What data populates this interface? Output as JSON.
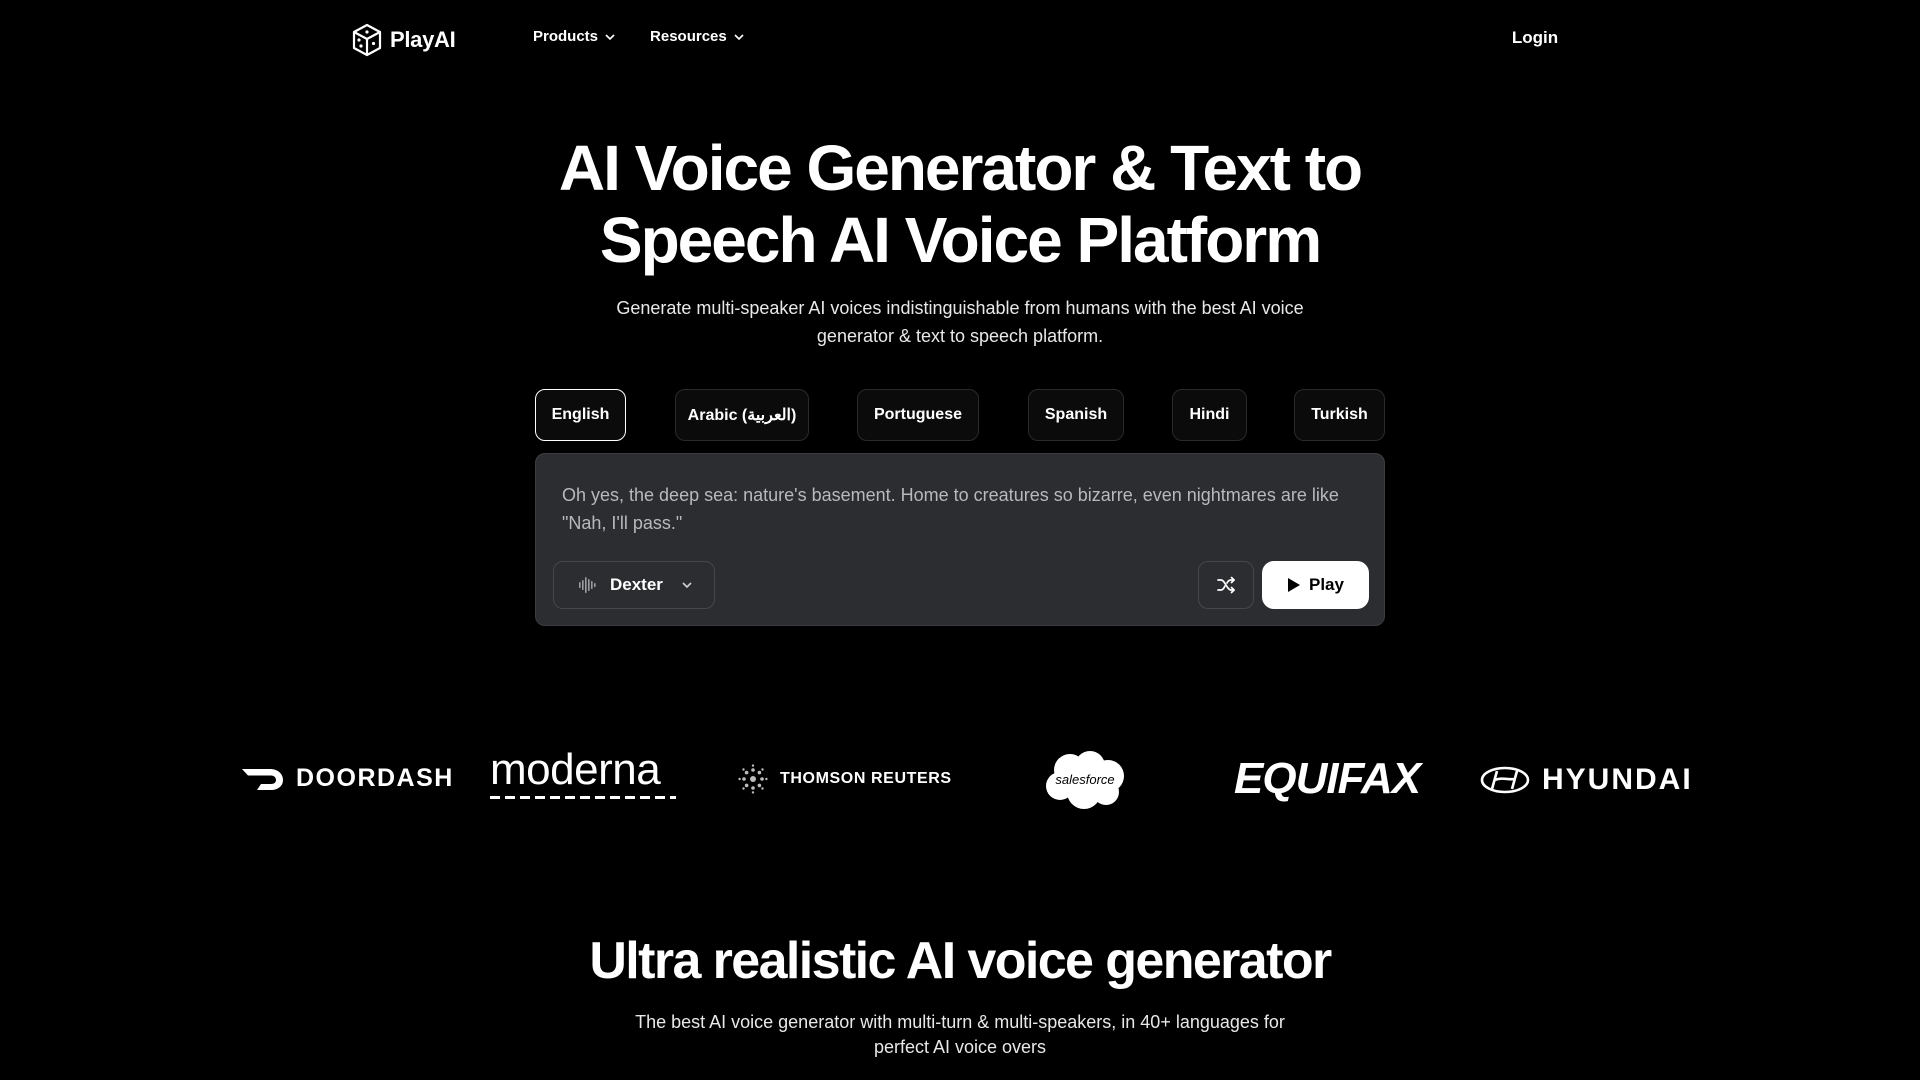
{
  "nav": {
    "brand": "PlayAI",
    "menu": [
      {
        "label": "Products"
      },
      {
        "label": "Resources"
      }
    ],
    "login": "Login"
  },
  "hero": {
    "title_line1": "AI Voice Generator & Text to",
    "title_line2": "Speech AI Voice Platform",
    "subtitle_line1": "Generate multi-speaker AI voices indistinguishable from humans with the best AI voice",
    "subtitle_line2": "generator & text to speech platform."
  },
  "languages": {
    "active": "English",
    "tabs": [
      "English",
      "Arabic (العربية)",
      "Portuguese",
      "Spanish",
      "Hindi",
      "Turkish"
    ]
  },
  "tts": {
    "text": "Oh yes, the deep sea: nature's basement. Home to creatures so bizarre, even nightmares are like \"Nah, I'll pass.\"",
    "voice": "Dexter",
    "play_label": "Play"
  },
  "logos": {
    "doordash": "DOORDASH",
    "moderna": "moderna",
    "thomson_reuters": "THOMSON REUTERS",
    "salesforce": "salesforce",
    "equifax": "EQUIFAX",
    "hyundai": "HYUNDAI"
  },
  "section2": {
    "title": "Ultra realistic AI voice generator",
    "subtitle_line1": "The best AI voice generator with multi-turn & multi-speakers, in 40+ languages for",
    "subtitle_line2": "perfect AI voice overs"
  },
  "icons": {
    "logo": "cube-dice-icon",
    "nav_chevron": "chevron-down-icon",
    "voice": "waveform-icon",
    "shuffle": "shuffle-icon",
    "play": "play-icon"
  },
  "colors": {
    "background": "#000000",
    "text": "#ffffff",
    "input_bg": "#2b2d30",
    "play_bg": "#ffffff"
  }
}
